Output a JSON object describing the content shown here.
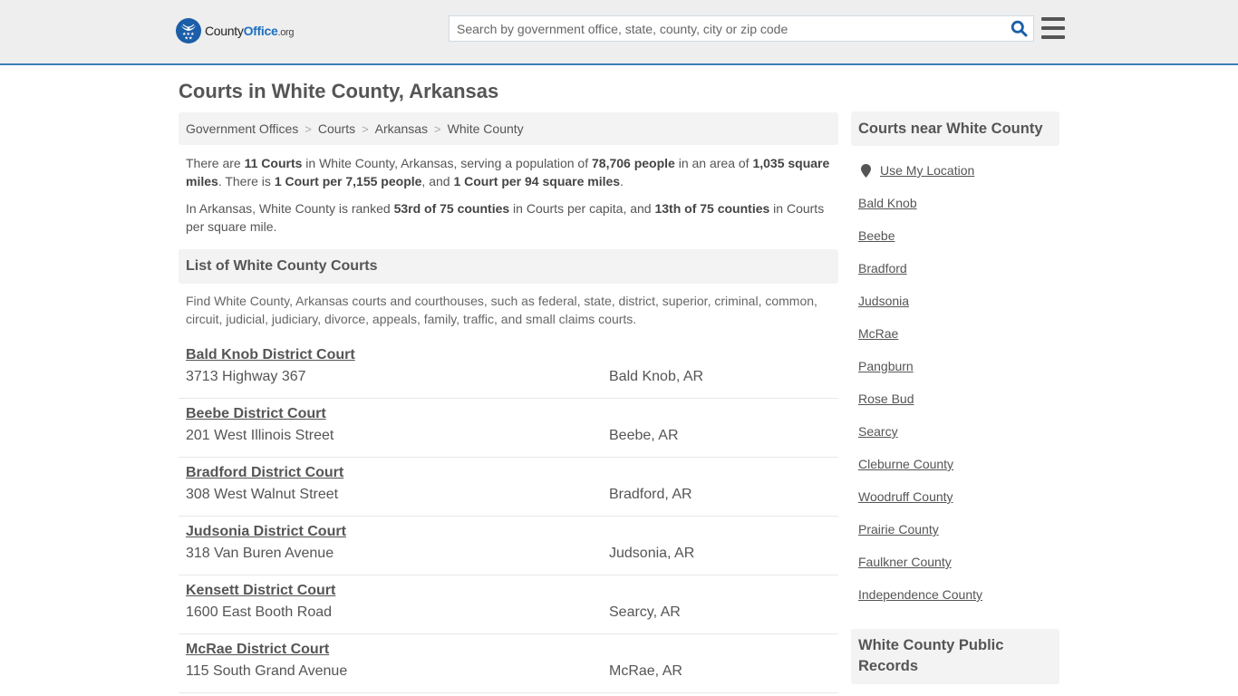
{
  "header": {
    "logo": {
      "text_prefix": "County",
      "text_brand": "Office",
      "text_suffix": ".org",
      "icon": "eagle-stars-logo-icon"
    },
    "search": {
      "placeholder": "Search by government office, state, county, city or zip code",
      "value": "",
      "icon": "search-icon"
    },
    "menu_icon": "hamburger-menu-icon",
    "colors": {
      "accent_border": "#3a7fb5",
      "brand_blue": "#1c5ea8"
    }
  },
  "page": {
    "title": "Courts in White County, Arkansas"
  },
  "breadcrumb": [
    {
      "label": "Government Offices"
    },
    {
      "label": "Courts"
    },
    {
      "label": "Arkansas"
    },
    {
      "label": "White County"
    }
  ],
  "intro": {
    "p1": {
      "t1": "There are ",
      "b1": "11 Courts",
      "t2": " in White County, Arkansas, serving a population of ",
      "b2": "78,706 people",
      "t3": " in an area of ",
      "b3": "1,035 square miles",
      "t4": ". There is ",
      "b4": "1 Court per 7,155 people",
      "t5": ", and ",
      "b5": "1 Court per 94 square miles",
      "t6": "."
    },
    "p2": {
      "t1": "In Arkansas, White County is ranked ",
      "b1": "53rd of 75 counties",
      "t2": " in Courts per capita, and ",
      "b2": "13th of 75 counties",
      "t3": " in Courts per square mile."
    }
  },
  "list": {
    "heading": "List of White County Courts",
    "description": "Find White County, Arkansas courts and courthouses, such as federal, state, district, superior, criminal, common, circuit, judicial, judiciary, divorce, appeals, family, traffic, and small claims courts.",
    "courts": [
      {
        "name": "Bald Knob District Court",
        "address": "3713 Highway 367",
        "city": "Bald Knob, AR"
      },
      {
        "name": "Beebe District Court",
        "address": "201 West Illinois Street",
        "city": "Beebe, AR"
      },
      {
        "name": "Bradford District Court",
        "address": "308 West Walnut Street",
        "city": "Bradford, AR"
      },
      {
        "name": "Judsonia District Court",
        "address": "318 Van Buren Avenue",
        "city": "Judsonia, AR"
      },
      {
        "name": "Kensett District Court",
        "address": "1600 East Booth Road",
        "city": "Searcy, AR"
      },
      {
        "name": "McRae District Court",
        "address": "115 South Grand Avenue",
        "city": "McRae, AR"
      }
    ]
  },
  "sidebar": {
    "nearby_heading": "Courts near White County",
    "use_location": {
      "label": "Use My Location",
      "icon": "map-pin-icon"
    },
    "links": [
      "Bald Knob",
      "Beebe",
      "Bradford",
      "Judsonia",
      "McRae",
      "Pangburn",
      "Rose Bud",
      "Searcy",
      "Cleburne County",
      "Woodruff County",
      "Prairie County",
      "Faulkner County",
      "Independence County"
    ],
    "records_heading": "White County Public Records"
  }
}
